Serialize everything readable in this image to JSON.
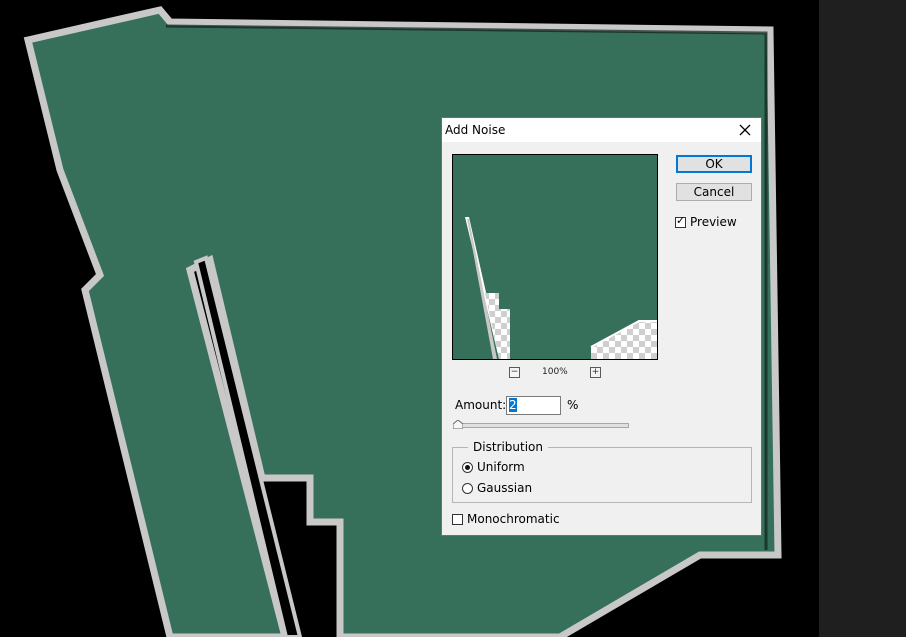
{
  "dialog": {
    "title": "Add Noise",
    "ok_label": "OK",
    "cancel_label": "Cancel",
    "preview_label": "Preview",
    "preview_checked": true,
    "zoom_label": "100%",
    "zoom_out_icon": "minus-icon",
    "zoom_in_icon": "plus-icon",
    "amount_label": "Amount:",
    "amount_value": "2",
    "amount_unit": "%",
    "amount_slider_fraction": 0.02,
    "distribution_label": "Distribution",
    "uniform_label": "Uniform",
    "gaussian_label": "Gaussian",
    "selected_distribution": "Uniform",
    "monochromatic_label": "Monochromatic",
    "monochromatic_checked": false,
    "close_icon": "close-icon"
  },
  "colors": {
    "canvas_background": "#000000",
    "shape_fill": "#37705a",
    "shape_stroke": "#c8c8c8",
    "panel_background": "#1f1f1f",
    "dialog_background": "#f0f0f0",
    "accent": "#0078d7"
  }
}
